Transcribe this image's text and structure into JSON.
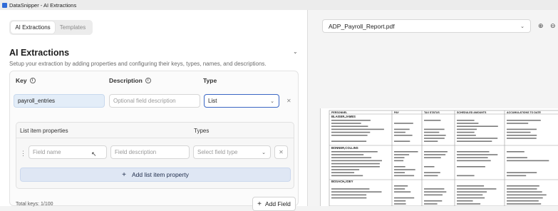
{
  "window": {
    "title": "DataSnipper - AI Extractions"
  },
  "tabs": [
    {
      "label": "AI Extractions",
      "active": true
    },
    {
      "label": "Templates",
      "active": false
    }
  ],
  "section": {
    "title": "AI Extractions",
    "subtitle": "Setup your extraction by adding properties and configuring their keys, types, names, and descriptions."
  },
  "columns": {
    "key": "Key",
    "description": "Description",
    "type": "Type"
  },
  "field": {
    "key_value": "payroll_entries",
    "description_placeholder": "Optional field description",
    "type_value": "List"
  },
  "list_items": {
    "properties_header": "List item properties",
    "types_header": "Types",
    "name_placeholder": "Field name",
    "description_placeholder": "Field description",
    "type_placeholder": "Select field type",
    "add_label": "Add list item property"
  },
  "footer": {
    "total_keys": "Total keys: 1/100",
    "add_field_label": "Add Field"
  },
  "viewer": {
    "file_name": "ADP_Payroll_Report.pdf"
  },
  "pdf_preview": {
    "headers": [
      "PERSONNEL",
      "PAY",
      "TAX STATUS",
      "SCHEDULED AMOUNTS",
      "ACCUMULATIONS TO DATE"
    ],
    "names": [
      "BLAISER,JAMES",
      "BONNER,COLLINS",
      "BOSACH,JOEY"
    ]
  },
  "colors": {
    "accent": "#3b67c4",
    "add_button_bg": "#dfe7f4",
    "key_bg": "#e3edf8"
  }
}
